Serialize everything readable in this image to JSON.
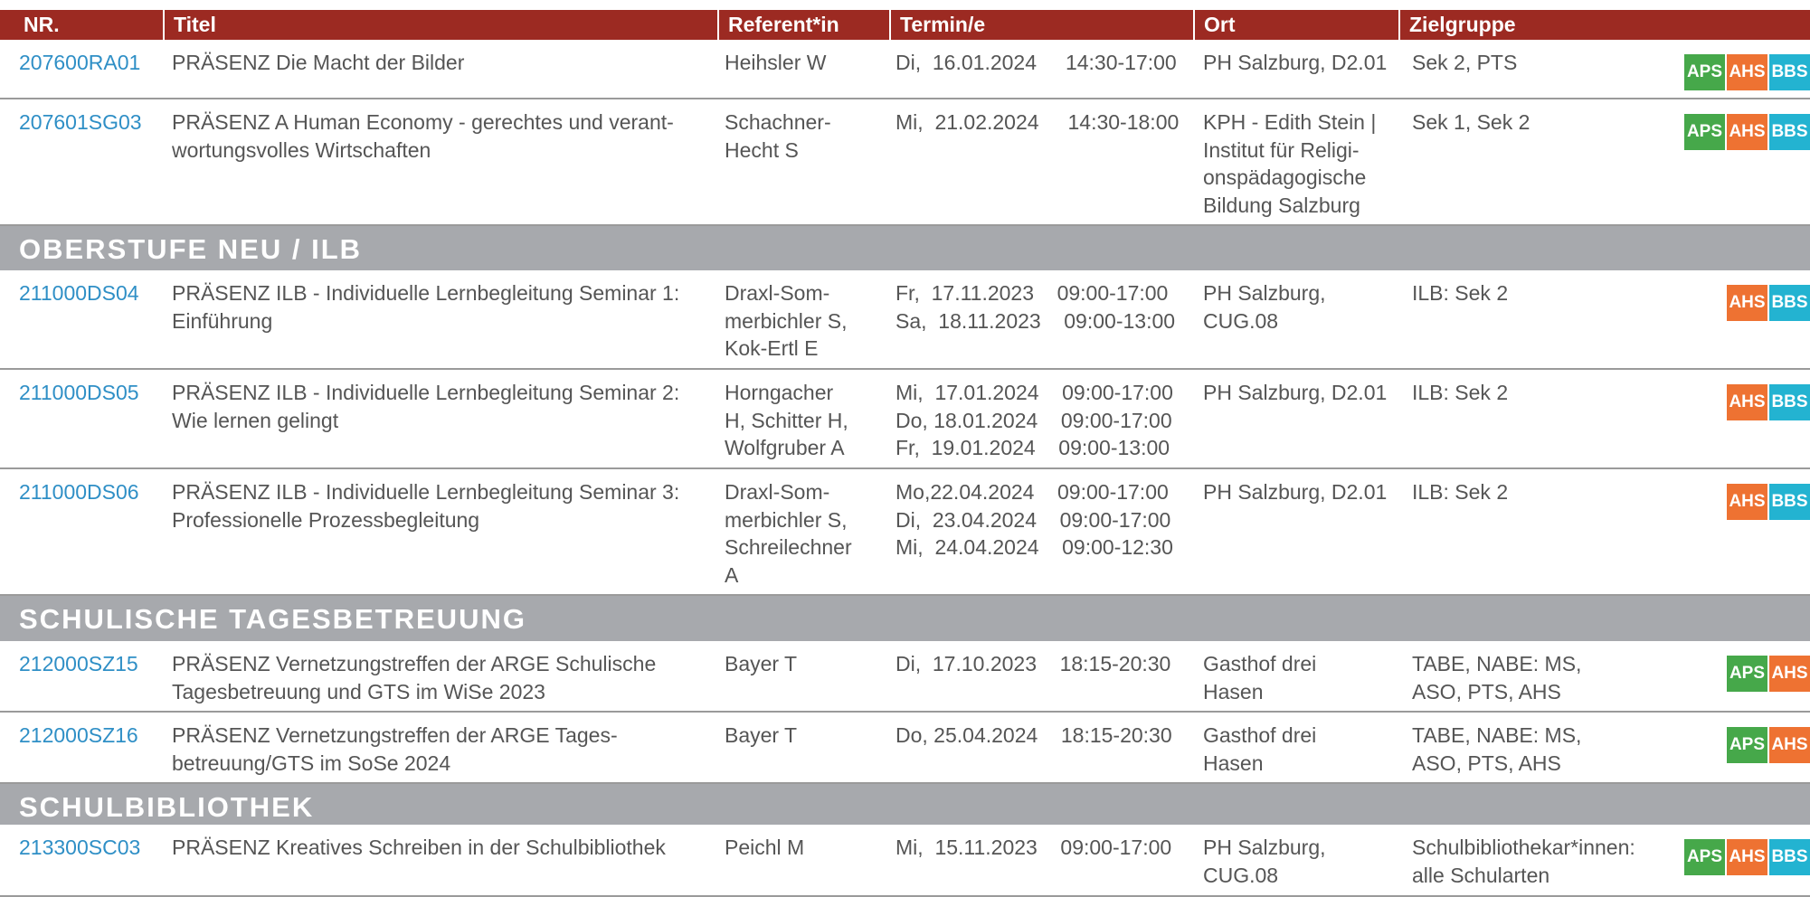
{
  "header": {
    "nr": "NR.",
    "titel": "Titel",
    "referent": "Referent*in",
    "termin": "Termin/e",
    "ort": "Ort",
    "zielgruppe": "Zielgruppe"
  },
  "badge_colors": {
    "APS": "#46a84a",
    "AHS": "#ee7232",
    "BBS": "#23b3d1"
  },
  "rows_top": [
    {
      "nr": "207600RA01",
      "titel": "PRÄSENZ Die Macht der Bilder",
      "referent": "Heihsler W",
      "termin": "Di,  16.01.2024     14:30-17:00",
      "ort": "PH Salzburg, D2.01",
      "ziel": "Sek 2, PTS",
      "badges": [
        "APS",
        "AHS",
        "BBS"
      ]
    },
    {
      "nr": "207601SG03",
      "titel": "PRÄSENZ A Human Economy - gerechtes und verant-\nwortungsvolles Wirtschaften",
      "referent": "Schachner-\nHecht S",
      "termin": "Mi,  21.02.2024     14:30-18:00",
      "ort": "KPH - Edith Stein |\nInstitut für Religi-\nonspädagogische\nBildung Salzburg",
      "ziel": "Sek 1, Sek 2",
      "badges": [
        "APS",
        "AHS",
        "BBS"
      ]
    }
  ],
  "sections": [
    {
      "title": "OBERSTUFE NEU / ILB",
      "rows": [
        {
          "nr": "211000DS04",
          "titel": "PRÄSENZ ILB - Individuelle Lernbegleitung Seminar 1:\nEinführung",
          "referent": "Draxl-Som-\nmerbichler S,\nKok-Ertl E",
          "termin": "Fr,  17.11.2023    09:00-17:00\nSa,  18.11.2023    09:00-13:00",
          "ort": "PH Salzburg,\nCUG.08",
          "ziel": "ILB: Sek 2",
          "badges": [
            "AHS",
            "BBS"
          ]
        },
        {
          "nr": "211000DS05",
          "titel": "PRÄSENZ ILB - Individuelle Lernbegleitung Seminar 2:\nWie lernen gelingt",
          "referent": "Horngacher\nH, Schitter H,\nWolfgruber A",
          "termin": "Mi,  17.01.2024    09:00-17:00\nDo, 18.01.2024    09:00-17:00\nFr,  19.01.2024    09:00-13:00",
          "ort": "PH Salzburg, D2.01",
          "ziel": "ILB: Sek 2",
          "badges": [
            "AHS",
            "BBS"
          ]
        },
        {
          "nr": "211000DS06",
          "titel": "PRÄSENZ ILB - Individuelle Lernbegleitung Seminar 3:\nProfessionelle Prozessbegleitung",
          "referent": "Draxl-Som-\nmerbichler S,\nSchreilechner\nA",
          "termin": "Mo,22.04.2024    09:00-17:00\nDi,  23.04.2024    09:00-17:00\nMi,  24.04.2024    09:00-12:30",
          "ort": "PH Salzburg, D2.01",
          "ziel": "ILB: Sek 2",
          "badges": [
            "AHS",
            "BBS"
          ]
        }
      ]
    },
    {
      "title": "SCHULISCHE TAGESBETREUUNG",
      "rows": [
        {
          "nr": "212000SZ15",
          "titel": "PRÄSENZ Vernetzungstreffen der ARGE Schulische\nTagesbetreuung und GTS im WiSe 2023",
          "referent": "Bayer T",
          "termin": "Di,  17.10.2023    18:15-20:30",
          "ort": "Gasthof drei\nHasen",
          "ziel": "TABE, NABE: MS,\nASO, PTS, AHS",
          "badges": [
            "APS",
            "AHS"
          ]
        },
        {
          "nr": "212000SZ16",
          "titel": "PRÄSENZ Vernetzungstreffen der ARGE Tages-\nbetreuung/GTS im SoSe 2024",
          "referent": "Bayer T",
          "termin": "Do, 25.04.2024    18:15-20:30",
          "ort": "Gasthof drei\nHasen",
          "ziel": "TABE, NABE: MS,\nASO, PTS, AHS",
          "badges": [
            "APS",
            "AHS"
          ]
        }
      ]
    },
    {
      "title": "SCHULBIBLIOTHEK",
      "rows": [
        {
          "nr": "213300SC03",
          "titel": "PRÄSENZ Kreatives Schreiben in der Schulbibliothek",
          "referent": "Peichl M",
          "termin": "Mi,  15.11.2023    09:00-17:00",
          "ort": "PH Salzburg,\nCUG.08",
          "ziel": "Schulbibliothekar*innen:\nalle Schularten",
          "badges": [
            "APS",
            "AHS",
            "BBS"
          ]
        }
      ]
    }
  ]
}
